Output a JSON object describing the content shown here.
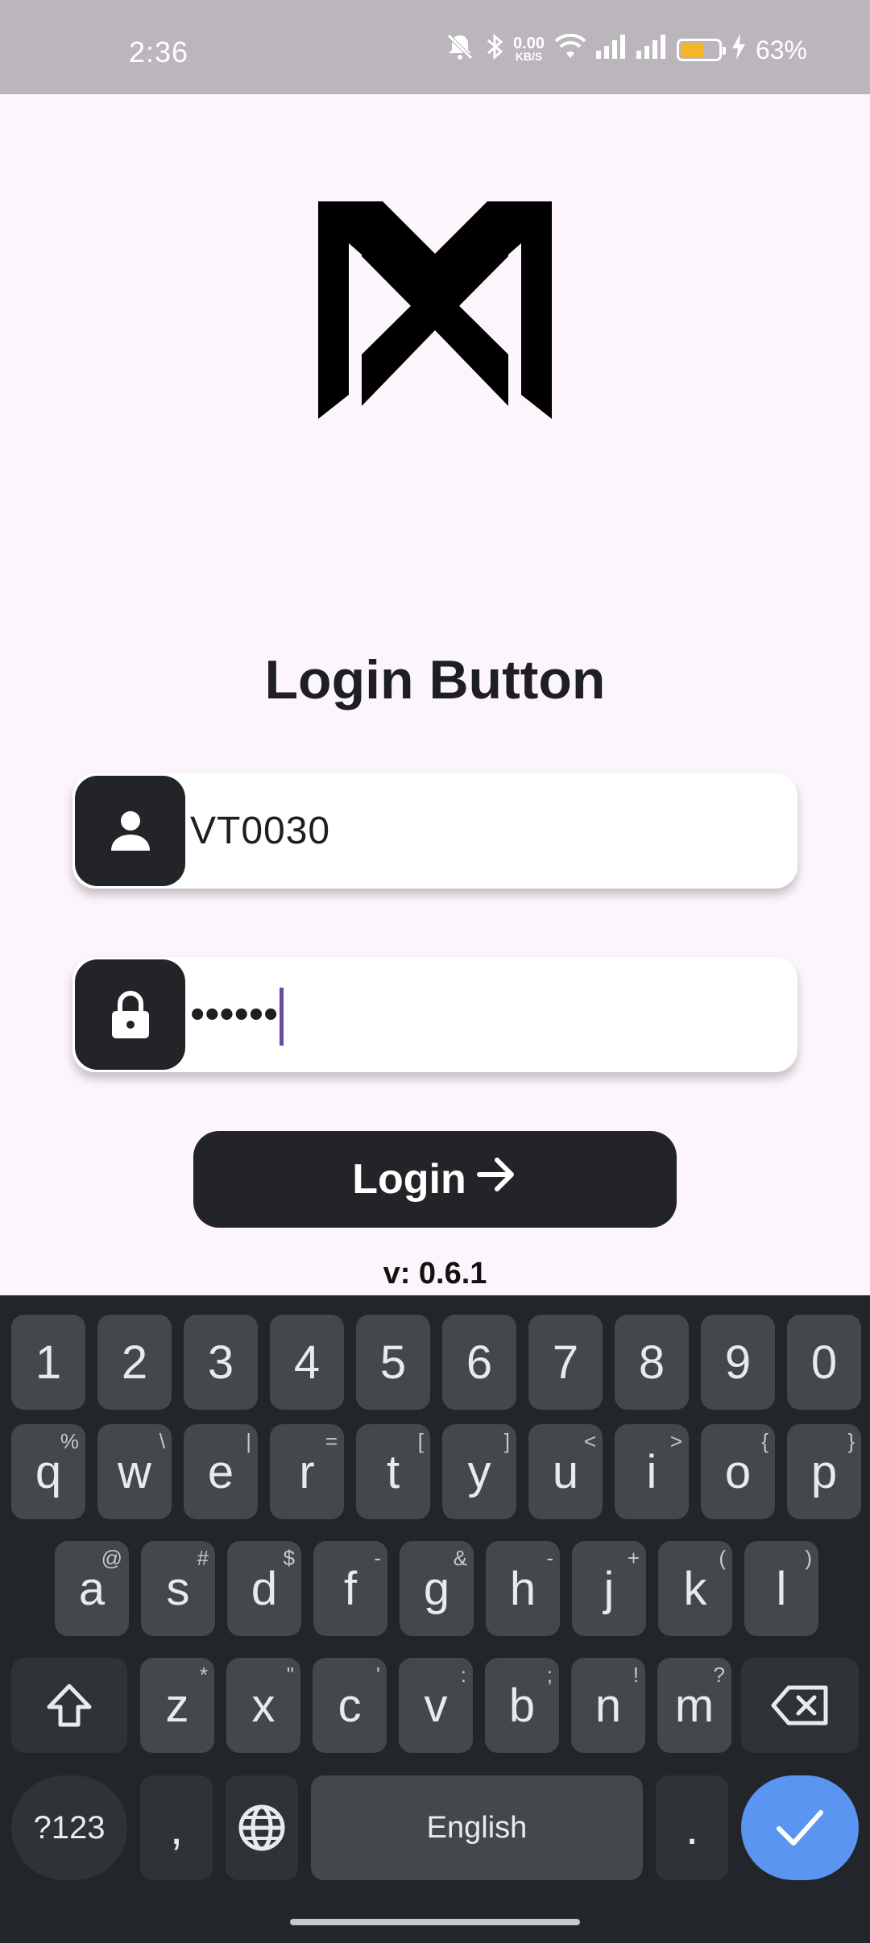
{
  "status_bar": {
    "time": "2:36",
    "speed_value": "0.00",
    "speed_unit": "KB/S",
    "battery": "63%",
    "battery_level": 0.63,
    "icons": [
      "mute-icon",
      "bluetooth-icon",
      "wifi-icon",
      "signal-icon",
      "signal-icon",
      "battery-icon",
      "charging-icon"
    ]
  },
  "login": {
    "title": "Login Button",
    "username_value": "VT0030",
    "password_value": "••••••",
    "button_label": "Login",
    "version": "v: 0.6.1"
  },
  "keyboard": {
    "row_numbers": [
      "1",
      "2",
      "3",
      "4",
      "5",
      "6",
      "7",
      "8",
      "9",
      "0"
    ],
    "row1": [
      {
        "k": "q",
        "h": "%"
      },
      {
        "k": "w",
        "h": "\\"
      },
      {
        "k": "e",
        "h": "|"
      },
      {
        "k": "r",
        "h": "="
      },
      {
        "k": "t",
        "h": "["
      },
      {
        "k": "y",
        "h": "]"
      },
      {
        "k": "u",
        "h": "<"
      },
      {
        "k": "i",
        "h": ">"
      },
      {
        "k": "o",
        "h": "{"
      },
      {
        "k": "p",
        "h": "}"
      }
    ],
    "row2": [
      {
        "k": "a",
        "h": "@"
      },
      {
        "k": "s",
        "h": "#"
      },
      {
        "k": "d",
        "h": "$"
      },
      {
        "k": "f",
        "h": "-"
      },
      {
        "k": "g",
        "h": "&"
      },
      {
        "k": "h",
        "h": "-"
      },
      {
        "k": "j",
        "h": "+"
      },
      {
        "k": "k",
        "h": "("
      },
      {
        "k": "l",
        "h": ")"
      }
    ],
    "row3": [
      {
        "k": "z",
        "h": "*"
      },
      {
        "k": "x",
        "h": "\""
      },
      {
        "k": "c",
        "h": "'"
      },
      {
        "k": "v",
        "h": ":"
      },
      {
        "k": "b",
        "h": ";"
      },
      {
        "k": "n",
        "h": "!"
      },
      {
        "k": "m",
        "h": "?"
      }
    ],
    "symbols_label": "?123",
    "comma": ",",
    "space_label": "English",
    "period": "."
  }
}
